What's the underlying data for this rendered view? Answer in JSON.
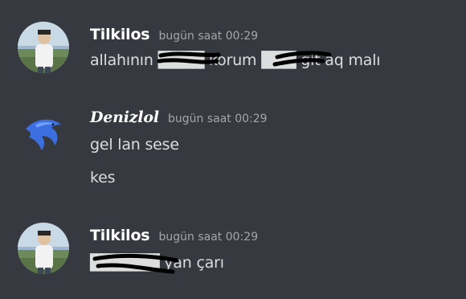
{
  "messages": [
    {
      "author": "Tilkilos",
      "timestamp": "bugün saat 00:29",
      "lines": [
        "allahının ████ korum ███ git aq malı"
      ]
    },
    {
      "author": "Denizlol",
      "timestamp": "bugün saat 00:29",
      "lines": [
        "gel lan sese",
        "kes"
      ]
    },
    {
      "author": "Tilkilos",
      "timestamp": "bugün saat 00:29",
      "lines": [
        "██████ yan çarı"
      ]
    }
  ],
  "colors": {
    "background": "#36393f",
    "username": "#ffffff",
    "timestamp": "#a3a6aa",
    "message_text": "#dcddde",
    "redaction": "#000000"
  },
  "icons": {
    "avatar_tilkilos": "person-photo-avatar",
    "avatar_denizlol": "blue-dolphin-avatar"
  }
}
